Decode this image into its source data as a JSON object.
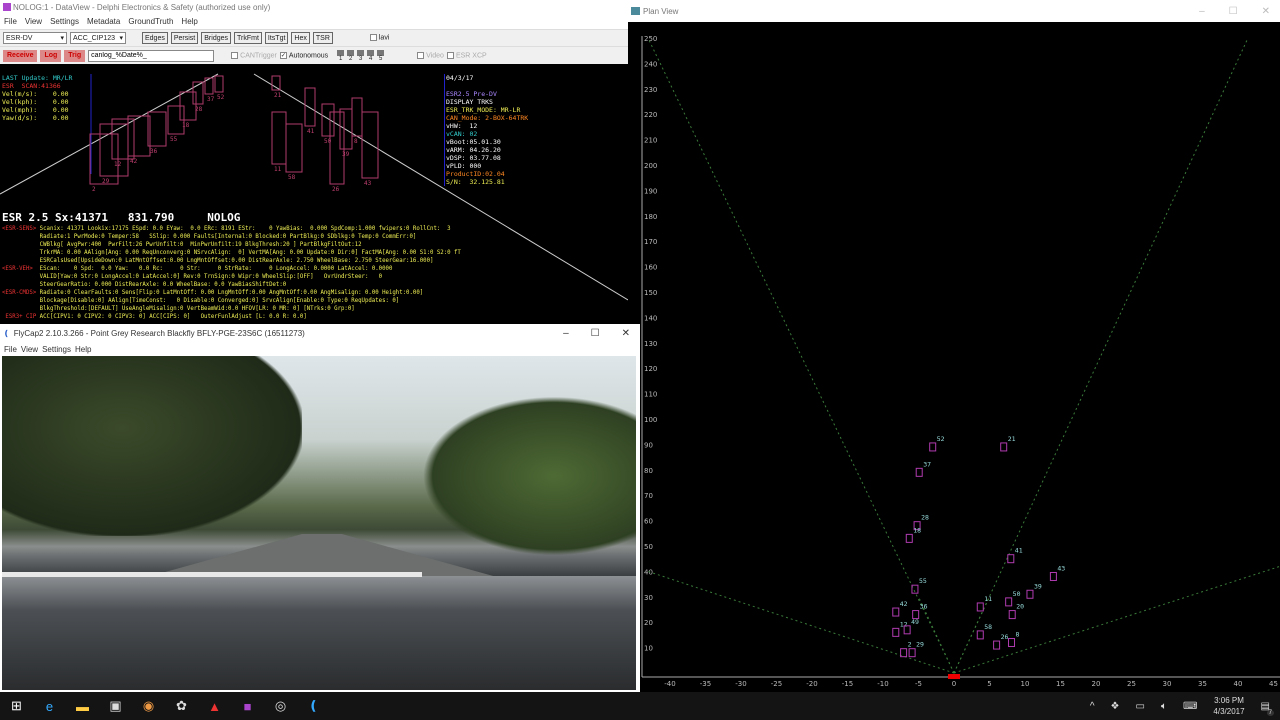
{
  "dataview": {
    "title": "NOLOG:1 - DataView - Delphi Electronics & Safety (authorized use only)",
    "menu": [
      "File",
      "View",
      "Settings",
      "Metadata",
      "GroundTruth",
      "Help"
    ],
    "toolbar1": {
      "device_select": "ESR-DV",
      "mode_select": "ACC_CIP123",
      "buttons": [
        "Edges",
        "Persist",
        "Bridges",
        "TrkFmt",
        "ItsTgt",
        "Hex",
        "TSR"
      ],
      "checkbox_label": "lavi"
    },
    "toolbar2": {
      "receive": "Receive",
      "log": "Log",
      "trig": "Trig",
      "filename": "canlog_%Date%_",
      "cantrigger": "CANTrigger",
      "autonomous": "Autonomous",
      "autonomous_checked": true,
      "channels": [
        "1",
        "2",
        "3",
        "4",
        "5"
      ],
      "video": "Video",
      "esrxcp": "ESR XCP"
    },
    "status": [
      {
        "text": "LAST Update: MR/LR",
        "color": "#3cc"
      },
      {
        "text": "ESR  SCAN:41366",
        "color": "#e33"
      },
      {
        "text": "Vel(m/s):    0.00",
        "color": "#ee5"
      },
      {
        "text": "Vel(kph):    0.00",
        "color": "#ee5"
      },
      {
        "text": "Vel(mph):    0.00",
        "color": "#ee5"
      },
      {
        "text": "Yaw(d/s):    0.00",
        "color": "#ee5"
      }
    ],
    "info": [
      {
        "text": "04/3/17",
        "color": "#fff"
      },
      {
        "text": "",
        "color": "#fff"
      },
      {
        "text": "ESR2.5 Pre-DV",
        "color": "#a8f"
      },
      {
        "text": "DISPLAY TRKS",
        "color": "#fff"
      },
      {
        "text": "ESR_TRK_MODE: MR-LR",
        "color": "#ee5"
      },
      {
        "text": "CAN_Mode: 2-BOX-64TRK",
        "color": "#f82"
      },
      {
        "text": "vHW:  12",
        "color": "#fff"
      },
      {
        "text": "vCAN: 02",
        "color": "#3cc"
      },
      {
        "text": "vBoot:05.01.30",
        "color": "#fff"
      },
      {
        "text": "vARM: 04.26.20",
        "color": "#fff"
      },
      {
        "text": "vDSP: 03.77.08",
        "color": "#fff"
      },
      {
        "text": "vPLD: 000",
        "color": "#fff"
      },
      {
        "text": "ProductID:02.04",
        "color": "#f82"
      },
      {
        "text": "S/N:  32.125.81",
        "color": "#ee5"
      }
    ],
    "radar_labels": [
      "2",
      "29",
      "12",
      "42",
      "36",
      "55",
      "18",
      "28",
      "37",
      "52",
      "21",
      "11",
      "58",
      "41",
      "50",
      "26",
      "39",
      "8",
      "43"
    ],
    "headline": "ESR 2.5 Sx:41371   831.790     NOLOG",
    "sens": [
      {
        "tag": "<ESR-SENS>",
        "text": " Scanix: 41371 Lookix:17175 ESpd: 0.0 EYaw:  0.0 ERc: 8191 EStr:    0 YawBias:  0.000 SpdComp:1.000 fwipers:0 RollCnt:  3"
      },
      {
        "tag": "",
        "text": "           Radiate:1 PwrMode:0 Temper:58   SSlip: 0.000 Faults[Internal:0 Blocked:0 PartBlkg:0 SDblkg:0 Temp:0 CommErr:0]"
      },
      {
        "tag": "",
        "text": "           CWBlkg[ AvgPwr:400  PwrFilt:26 PwrUnfilt:0  MinPwrUnfilt:19 BlkgThresh:20 ] PartBlkgFiltOut:12"
      },
      {
        "tag": "",
        "text": "           TrkrMA: 0.00 AAlign[Ang: 0.00 ReqUnconverg:0 NSrvcAlign:  0] VertMA[Ang: 0.00 Update:0 Dir:0] FactMA[Ang: 0.00 S1:0 S2:0 fT"
      },
      {
        "tag": "",
        "text": "           ESRCalsUsed[UpsideDown:0 LatMntOffset:0.00 LngMntOffset:0.00 DistRearAxle: 2.750 WheelBase: 2.750 SteerGear:16.000]"
      },
      {
        "tag": "<ESR-VEH> ",
        "text": " EScan:    0 Spd:  0.0 Yaw:   0.0 Rc:     0 Str:     0 StrRate:     0 LongAccel: 0.0000 LatAccel: 0.0000"
      },
      {
        "tag": "",
        "text": "           VALID[Yaw:0 Str:0 LongAccel:0 LatAccel:0] Rev:0 TrnSign:0 Wipr:0 WheelSlip:[OFF]   OvrUndrSteer:   0"
      },
      {
        "tag": "",
        "text": "           SteerGearRatio: 0.000 DistRearAxle: 0.0 WheelBase: 0.0 YawBiasShiftDet:0"
      },
      {
        "tag": "<ESR-CMDS>",
        "text": " Radiate:0 ClearFaults:0 Sens[Flip:0 LatMntOff: 0.00 LngMntOff:0.00 AngMntOff:0.00 AngMisalign: 0.00 Height:0.00]"
      },
      {
        "tag": "",
        "text": "           Blockage[Disable:0] AAlign[TimeConst:   0 Disable:0 Converged:0] SrvcAlign[Enable:0 Type:0 ReqUpdates: 0]"
      },
      {
        "tag": "",
        "text": "           BlkgThreshold:[DEFAULT] UseAngleMisalign:0 VertBeamWid:0.0 HFOV[LR: 0 MR: 0] [NTrks:0 Grp:0]"
      },
      {
        "tag": " ESR3+ CIP",
        "text": " ACC[CIPV1: 0 CIPV2: 0 CIPV3: 0] ACC[CIPS: 0]   OuterFunlAdjust [L: 0.0 R: 0.0]"
      }
    ]
  },
  "planview": {
    "title": "Plan View",
    "chart_data": {
      "type": "scatter",
      "x_ticks": [
        -40,
        -35,
        -30,
        -25,
        -20,
        -15,
        -10,
        -5,
        0,
        5,
        10,
        15,
        20,
        25,
        30,
        35,
        40,
        45
      ],
      "y_ticks": [
        10,
        20,
        30,
        40,
        50,
        60,
        70,
        80,
        90,
        100,
        110,
        120,
        130,
        140,
        150,
        160,
        170,
        180,
        190,
        200,
        210,
        220,
        230,
        240,
        250
      ],
      "xlim": [
        -42,
        45
      ],
      "ylim": [
        0,
        252
      ],
      "tracks": [
        {
          "id": "52",
          "x": -3.0,
          "y": 89
        },
        {
          "id": "37",
          "x": -4.9,
          "y": 79
        },
        {
          "id": "21",
          "x": 7.0,
          "y": 89
        },
        {
          "id": "28",
          "x": -5.2,
          "y": 58
        },
        {
          "id": "18",
          "x": -6.3,
          "y": 53
        },
        {
          "id": "41",
          "x": 8.0,
          "y": 45
        },
        {
          "id": "43",
          "x": 14.0,
          "y": 38
        },
        {
          "id": "55",
          "x": -5.5,
          "y": 33
        },
        {
          "id": "39",
          "x": 10.7,
          "y": 31
        },
        {
          "id": "50",
          "x": 7.7,
          "y": 28
        },
        {
          "id": "20",
          "x": 8.2,
          "y": 23
        },
        {
          "id": "11",
          "x": 3.7,
          "y": 26
        },
        {
          "id": "42",
          "x": -8.2,
          "y": 24
        },
        {
          "id": "36",
          "x": -5.4,
          "y": 23
        },
        {
          "id": "12",
          "x": -8.2,
          "y": 16
        },
        {
          "id": "49",
          "x": -6.6,
          "y": 17
        },
        {
          "id": "58",
          "x": 3.7,
          "y": 15
        },
        {
          "id": "26",
          "x": 6.0,
          "y": 11
        },
        {
          "id": "8",
          "x": 8.1,
          "y": 12
        },
        {
          "id": "2",
          "x": -7.1,
          "y": 8
        },
        {
          "id": "29",
          "x": -5.9,
          "y": 8
        }
      ],
      "track_color": "#b03cb0",
      "label_color": "#9dd",
      "fov_color": "#3a7a3a",
      "host_color": "#e00"
    }
  },
  "flycap": {
    "title": "FlyCap2 2.10.3.266 - Point Grey Research Blackfly BFLY-PGE-23S6C (16511273)",
    "menu": [
      "File",
      "View",
      "Settings",
      "Help"
    ]
  },
  "taskbar": {
    "time": "3:06 PM",
    "date": "4/3/2017",
    "notifications": "7"
  }
}
